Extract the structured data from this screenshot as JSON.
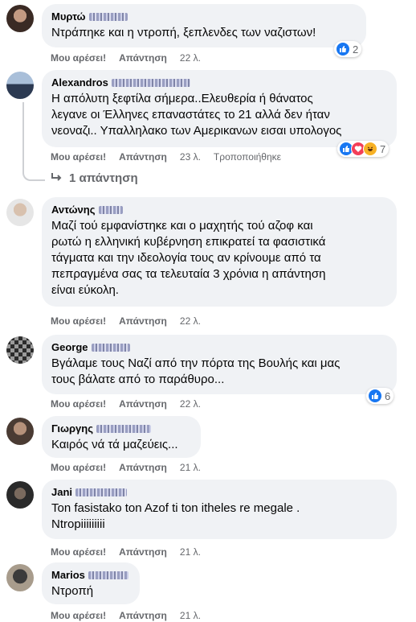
{
  "labels": {
    "like": "Μου αρέσει!",
    "reply": "Απάντηση"
  },
  "colors": {
    "like_blue": "#1877f2",
    "love_red": "#f33e58",
    "haha_yellow": "#f7b125"
  },
  "comments": [
    {
      "author": "Μυρτώ",
      "text": "Ντράπηκε και η ντροπή, ξεπλενδες των ναζιστων!",
      "time": "22 λ.",
      "reactions": "2",
      "reaction_icons": [
        "like-icon"
      ]
    },
    {
      "author": "Alexandros",
      "text": "Η απόλυτη ξεφτίλα σήμερα..Ελευθερία ή θάνατος\nλεγανε οι Έλληνες επαναστάτες το 21 αλλά δεν ήταν\nνεοναζι.. Υπαλληλακο των Αμερικανων εισαι υπολογος",
      "time": "23 λ.",
      "edited": "Τροποποιήθηκε",
      "reactions": "7",
      "reaction_icons": [
        "like-icon",
        "love-icon",
        "haha-icon"
      ],
      "replies": "1 απάντηση"
    },
    {
      "author": "Αντώνης",
      "text": "Μαζί τού εμφανίστηκε και ο μαχητής τού αζοφ και\nρωτώ η ελληνική κυβέρνηση επικρατεί τα φασιστικά\nτάγματα και την ιδεολογία τους αν κρίνουμε από τα\nπεπραγμένα σας τα τελευταία 3 χρόνια η απάντηση\nείναι εύκολη.",
      "time": "22 λ."
    },
    {
      "author": "George",
      "text": "Βγάλαμε τους Ναζί από την πόρτα της Βουλής και μας\nτους βάλατε από το παράθυρο...",
      "time": "22 λ.",
      "reactions": "6",
      "reaction_icons": [
        "like-icon"
      ]
    },
    {
      "author": "Γιωργης",
      "text": "Καιρός νά τά μαζεύεις...",
      "time": "21 λ."
    },
    {
      "author": "Jani",
      "text": "Ton fasistako ton Azof ti ton itheles re megale .\nNtropiiiiiiiii",
      "time": "21 λ."
    },
    {
      "author": "Marios",
      "text": "Ντροπή",
      "time": "21 λ."
    }
  ]
}
